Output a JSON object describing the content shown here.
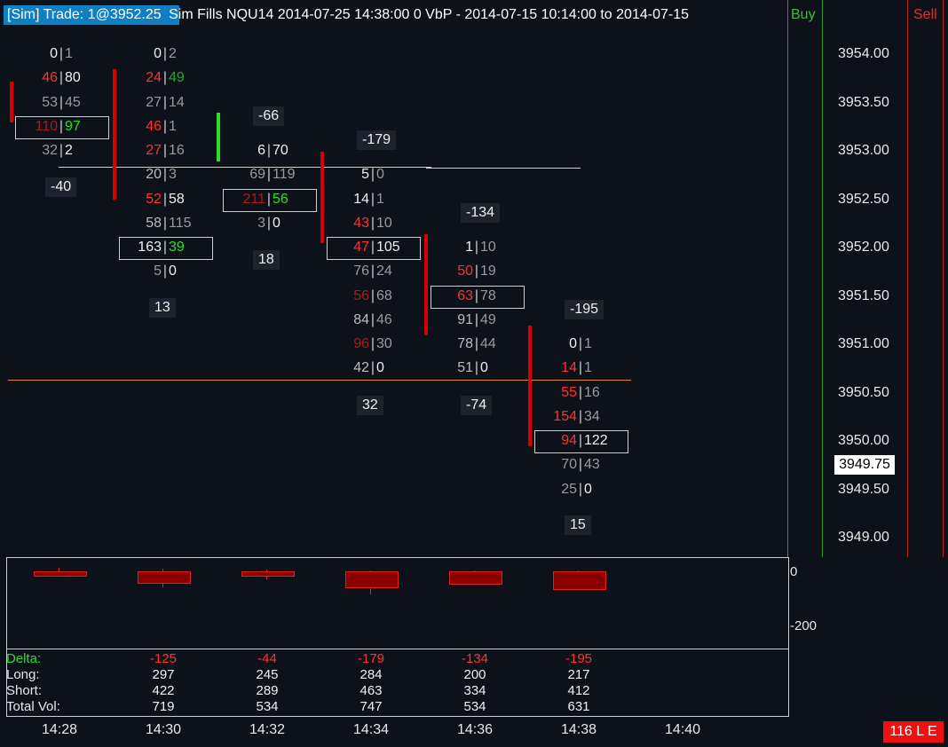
{
  "header": {
    "sim_label": "[Sim]  Trade: 1@3952.25",
    "title": "Sim Fills  NQU14 2014-07-25 14:38:00 0  VbP - 2014-07-15  10:14:00 to 2014-07-15",
    "buy_label": "Buy",
    "sell_label": "Sell"
  },
  "price_axis": {
    "labels": [
      "3954.00",
      "3953.50",
      "3953.00",
      "3952.50",
      "3952.00",
      "3951.50",
      "3951.00",
      "3950.50",
      "3950.00",
      "3949.50",
      "3949.00"
    ],
    "current": "3949.75"
  },
  "columns": [
    {
      "cells": [
        {
          "l": "0",
          "r": "1",
          "lc": "white",
          "rc": "grey"
        },
        {
          "l": "46",
          "r": "80",
          "lc": "red",
          "rc": "white"
        },
        {
          "l": "53",
          "r": "45",
          "lc": "grey",
          "rc": "grey"
        },
        {
          "l": "110",
          "r": "97",
          "lc": "dred",
          "rc": "green",
          "boxed": true
        },
        {
          "l": "32",
          "r": "2",
          "lc": "grey",
          "rc": "white"
        }
      ],
      "delta": "-40"
    },
    {
      "cells": [
        {
          "l": "0",
          "r": "2",
          "lc": "white",
          "rc": "grey"
        },
        {
          "l": "24",
          "r": "49",
          "lc": "red",
          "rc": "dgreen"
        },
        {
          "l": "27",
          "r": "14",
          "lc": "grey",
          "rc": "grey"
        },
        {
          "l": "46",
          "r": "1",
          "lc": "red",
          "rc": "grey"
        },
        {
          "l": "27",
          "r": "16",
          "lc": "red",
          "rc": "grey"
        },
        {
          "l": "20",
          "r": "3",
          "lc": "lgrey",
          "rc": "grey"
        },
        {
          "l": "52",
          "r": "58",
          "lc": "red",
          "rc": "white"
        },
        {
          "l": "58",
          "r": "115",
          "lc": "lgrey",
          "rc": "grey"
        },
        {
          "l": "163",
          "r": "39",
          "lc": "white",
          "rc": "green",
          "boxed": true
        },
        {
          "l": "5",
          "r": "0",
          "lc": "grey",
          "rc": "white"
        }
      ],
      "delta": "13"
    },
    {
      "cells": [
        {
          "l": "6",
          "r": "70",
          "lc": "white",
          "rc": "white"
        },
        {
          "l": "69",
          "r": "119",
          "lc": "grey",
          "rc": "grey"
        },
        {
          "l": "211",
          "r": "56",
          "lc": "dred",
          "rc": "green",
          "boxed": true
        },
        {
          "l": "3",
          "r": "0",
          "lc": "grey",
          "rc": "white"
        }
      ],
      "delta_top": "-66",
      "delta": "18"
    },
    {
      "cells": [
        {
          "l": "5",
          "r": "0",
          "lc": "white",
          "rc": "grey"
        },
        {
          "l": "14",
          "r": "1",
          "lc": "white",
          "rc": "grey"
        },
        {
          "l": "43",
          "r": "10",
          "lc": "red",
          "rc": "grey"
        },
        {
          "l": "47",
          "r": "105",
          "lc": "red",
          "rc": "white",
          "boxed": true
        },
        {
          "l": "76",
          "r": "24",
          "lc": "grey",
          "rc": "grey"
        },
        {
          "l": "56",
          "r": "68",
          "lc": "dred",
          "rc": "grey"
        },
        {
          "l": "84",
          "r": "46",
          "lc": "lgrey",
          "rc": "grey"
        },
        {
          "l": "96",
          "r": "30",
          "lc": "dred",
          "rc": "grey"
        },
        {
          "l": "42",
          "r": "0",
          "lc": "lgrey",
          "rc": "white"
        }
      ],
      "delta_top": "-179",
      "delta": "32"
    },
    {
      "cells": [
        {
          "l": "1",
          "r": "10",
          "lc": "white",
          "rc": "grey"
        },
        {
          "l": "50",
          "r": "19",
          "lc": "red",
          "rc": "grey"
        },
        {
          "l": "63",
          "r": "78",
          "lc": "red",
          "rc": "grey",
          "boxed": true
        },
        {
          "l": "91",
          "r": "49",
          "lc": "lgrey",
          "rc": "grey"
        },
        {
          "l": "78",
          "r": "44",
          "lc": "lgrey",
          "rc": "grey"
        },
        {
          "l": "51",
          "r": "0",
          "lc": "lgrey",
          "rc": "white"
        }
      ],
      "delta_top": "-134",
      "delta": "-74"
    },
    {
      "cells": [
        {
          "l": "0",
          "r": "1",
          "lc": "white",
          "rc": "grey"
        },
        {
          "l": "14",
          "r": "1",
          "lc": "red",
          "rc": "grey"
        },
        {
          "l": "55",
          "r": "16",
          "lc": "red",
          "rc": "grey"
        },
        {
          "l": "154",
          "r": "34",
          "lc": "red",
          "rc": "grey"
        },
        {
          "l": "94",
          "r": "122",
          "lc": "red",
          "rc": "white",
          "boxed": true
        },
        {
          "l": "70",
          "r": "43",
          "lc": "grey",
          "rc": "grey"
        },
        {
          "l": "25",
          "r": "0",
          "lc": "grey",
          "rc": "white"
        }
      ],
      "delta_top": "-195",
      "delta": "15"
    }
  ],
  "delta_axis": {
    "zero": "0",
    "low": "-200"
  },
  "stats": {
    "labels": {
      "delta": "Delta:",
      "long": "Long:",
      "short": "Short:",
      "total": "Total Vol:"
    },
    "delta": [
      "-125",
      "-44",
      "-179",
      "-134",
      "-195"
    ],
    "long": [
      "297",
      "245",
      "284",
      "200",
      "217"
    ],
    "short": [
      "422",
      "289",
      "463",
      "334",
      "412"
    ],
    "total": [
      "719",
      "534",
      "747",
      "534",
      "631"
    ]
  },
  "time_axis": [
    "14:28",
    "14:30",
    "14:32",
    "14:34",
    "14:36",
    "14:38",
    "14:40"
  ],
  "status_badge": "116 L E",
  "colors": {
    "red": "#ff3030",
    "dred": "#b01818",
    "grey": "#9a9a9a",
    "white": "#f0f0f0",
    "green": "#2edc2e",
    "dgreen": "#26a826",
    "lgrey": "#bdbdbd"
  }
}
